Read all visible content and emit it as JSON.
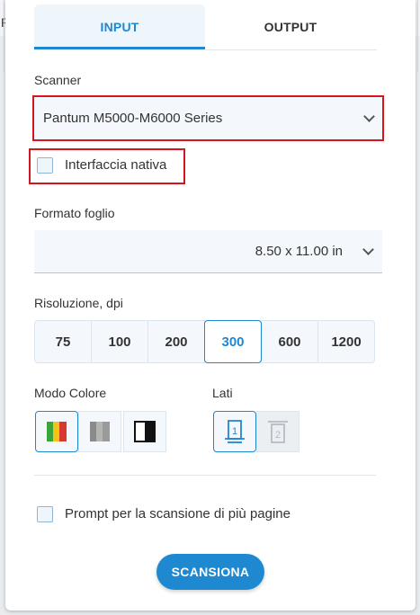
{
  "tabs": {
    "input": "INPUT",
    "output": "OUTPUT"
  },
  "background_fragment": "P",
  "scanner": {
    "label": "Scanner",
    "selected": "Pantum M5000-M6000 Series"
  },
  "native_interface": {
    "label": "Interfaccia nativa",
    "checked": false
  },
  "paper_size": {
    "label": "Formato foglio",
    "selected": "8.50 x 11.00 in"
  },
  "resolution": {
    "label": "Risoluzione, dpi",
    "options": [
      "75",
      "100",
      "200",
      "300",
      "600",
      "1200"
    ],
    "selected": "300"
  },
  "color_mode": {
    "label": "Modo Colore",
    "options": [
      "color-mode-icon",
      "grayscale-mode-icon",
      "black-white-mode-icon"
    ],
    "selected": "color-mode-icon"
  },
  "sides": {
    "label": "Lati",
    "options": [
      "single-side-icon",
      "double-side-icon"
    ],
    "selected": "single-side-icon"
  },
  "multi_page": {
    "label": "Prompt per la scansione di più pagine",
    "checked": false
  },
  "scan_button": "SCANSIONA",
  "colors": {
    "accent": "#1e88d0",
    "highlight": "#d4141e"
  }
}
